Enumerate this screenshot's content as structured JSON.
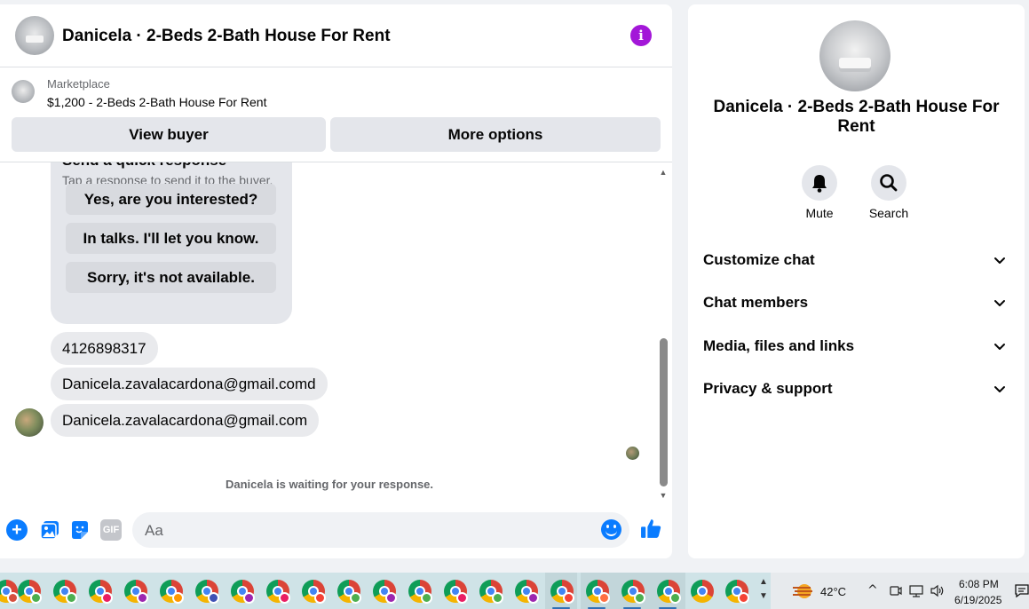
{
  "header": {
    "title": "Danicela · 2-Beds 2-Bath House For Rent",
    "info_icon": "info-icon",
    "accent": "#a317d8"
  },
  "marketplace": {
    "label": "Marketplace",
    "listing": "$1,200 - 2-Beds 2-Bath House For Rent",
    "view_buyer": "View buyer",
    "more_options": "More options"
  },
  "quick_response": {
    "title": "Send a quick response",
    "subtitle": "Tap a response to send it to the buyer.",
    "options": [
      "Yes, are you interested?",
      "In talks. I'll let you know.",
      "Sorry, it's not available."
    ]
  },
  "messages": [
    "4126898317",
    "Danicela.zavalacardona@gmail.comd",
    "Danicela.zavalacardona@gmail.com"
  ],
  "status": "Danicela is waiting for your response.",
  "composer": {
    "placeholder": "Aa",
    "gif_label": "GIF",
    "accent": "#0a7cff"
  },
  "info_panel": {
    "name": "Danicela · 2-Beds 2-Bath House For Rent",
    "actions": [
      {
        "label": "Mute",
        "icon": "bell-icon"
      },
      {
        "label": "Search",
        "icon": "search-icon"
      }
    ],
    "sections": [
      "Customize chat",
      "Chat members",
      "Media, files and links",
      "Privacy & support"
    ]
  },
  "taskbar": {
    "temperature": "42°C",
    "time": "6:08 PM",
    "date": "6/19/2025"
  }
}
